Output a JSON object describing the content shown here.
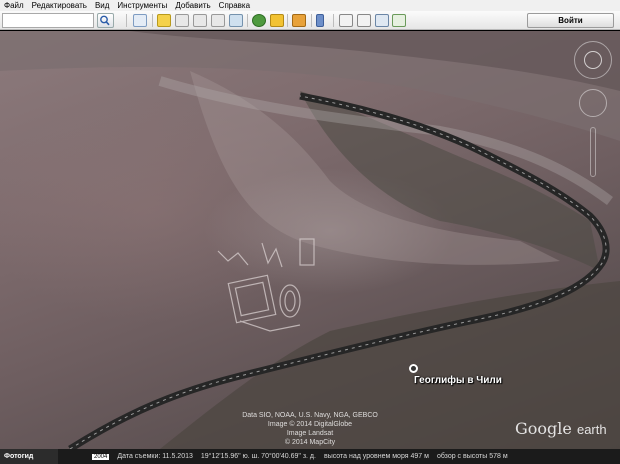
{
  "menu": [
    "Файл",
    "Редактировать",
    "Вид",
    "Инструменты",
    "Добавить",
    "Справка"
  ],
  "toolbar": {
    "search_value": "",
    "signin_label": "Войти",
    "icons": [
      "sidebar-icon",
      "placemark-icon",
      "polygon-icon",
      "path-icon",
      "image-overlay-icon",
      "tour-icon",
      "historical-imagery-icon",
      "sunlight-icon",
      "planets-icon",
      "ruler-icon",
      "email-icon",
      "print-icon",
      "save-image-icon",
      "maps-icon"
    ]
  },
  "placemark": {
    "label": "Геоглифы в Чили"
  },
  "copyright": [
    "Data SIO, NOAA, U.S. Navy, NGA, GEBCO",
    "Image © 2014 DigitalGlobe",
    "Image Landsat",
    "© 2014 MapCity"
  ],
  "logo": {
    "google": "Google",
    "earth": "earth"
  },
  "status": {
    "tour_label": "Фотогид",
    "year": "2004",
    "date": "Дата съемки: 11.5.2013",
    "coords": "19°12'15.96\" ю. ш. 70°00'40.69\" з. д.",
    "altitude": "высота над уровнем моря    497 м",
    "eye": "обзор с высоты    578 м"
  },
  "colors": {
    "toolbar_bg": "#ececec",
    "status_bg": "#1b1b1b",
    "road": "#2b2b2b"
  }
}
